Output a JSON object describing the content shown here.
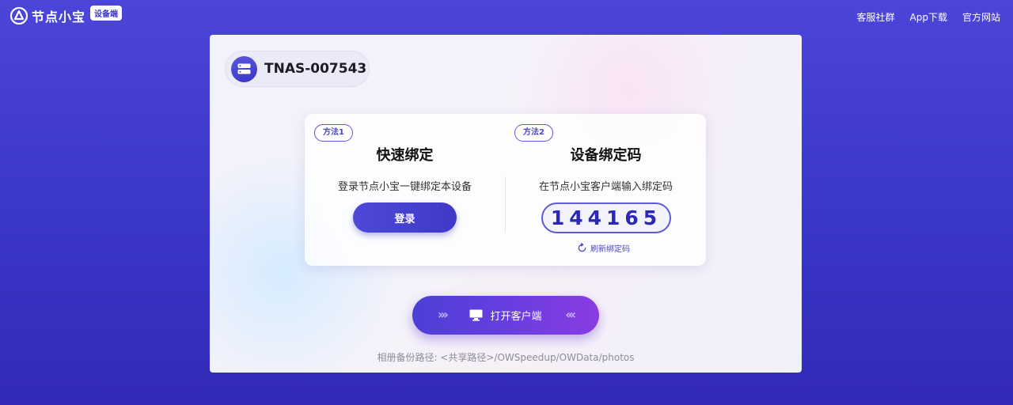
{
  "header": {
    "brand": "节点小宝",
    "badge": "设备端",
    "nav": [
      "客服社群",
      "App下载",
      "官方网站"
    ]
  },
  "device": {
    "name": "TNAS-007543",
    "icon": "server-icon"
  },
  "method1": {
    "tag": "方法1",
    "title": "快速绑定",
    "desc": "登录节点小宝一键绑定本设备",
    "button": "登录"
  },
  "method2": {
    "tag": "方法2",
    "title": "设备绑定码",
    "desc": "在节点小宝客户端输入绑定码",
    "code": "144165",
    "refresh": "刷新绑定码"
  },
  "open_client": {
    "label": "打开客户端"
  },
  "backup_path": "相册备份路径: <共享路径>/OWSpeedup/OWData/photos",
  "colors": {
    "accent": "#4a45d0",
    "background": "#3f3ad0",
    "button_gradient_end": "#8a3ce2"
  }
}
